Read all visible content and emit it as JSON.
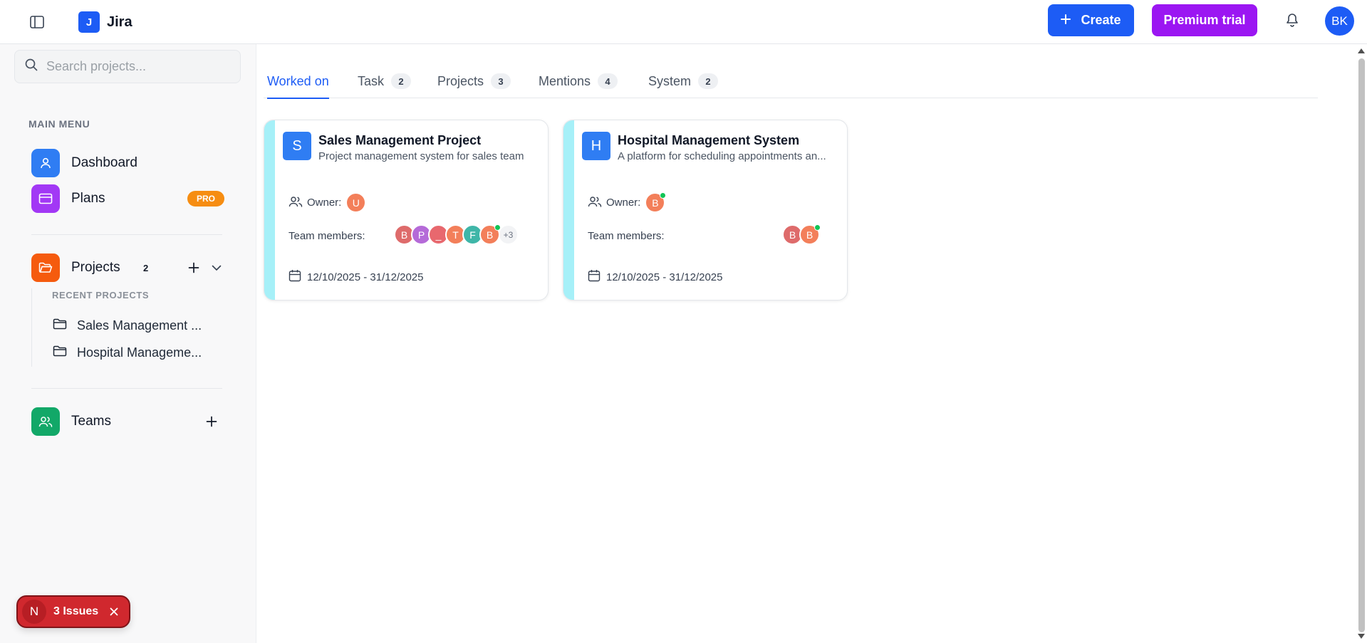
{
  "app": {
    "logo_letter": "J",
    "name": "Jira"
  },
  "header": {
    "create_label": "Create",
    "premium_label": "Premium trial",
    "user_initials": "BK"
  },
  "sidebar": {
    "search_placeholder": "Search projects...",
    "main_menu_title": "MAIN MENU",
    "dashboard_label": "Dashboard",
    "plans_label": "Plans",
    "plans_badge": "PRO",
    "projects_label": "Projects",
    "projects_count": "2",
    "recent_title": "RECENT PROJECTS",
    "recent_projects": [
      "Sales Management ...",
      "Hospital Manageme..."
    ],
    "teams_label": "Teams"
  },
  "issues": {
    "letter": "N",
    "label": "3 Issues"
  },
  "tabs": [
    {
      "label": "Worked on",
      "count": ""
    },
    {
      "label": "Task",
      "count": "2"
    },
    {
      "label": "Projects",
      "count": "3"
    },
    {
      "label": "Mentions",
      "count": "4"
    },
    {
      "label": "System",
      "count": "2"
    }
  ],
  "cards": [
    {
      "letter": "S",
      "title": "Sales Management Project",
      "description": "Project management system for sales team",
      "owner_label": "Owner:",
      "owner_initial": "U",
      "team_label": "Team members:",
      "team_initials": [
        "B",
        "P",
        "_",
        "T",
        "F",
        "B"
      ],
      "team_more": "+3",
      "dates": "12/10/2025 - 31/12/2025"
    },
    {
      "letter": "H",
      "title": "Hospital Management System",
      "description": "A platform for scheduling appointments an...",
      "owner_label": "Owner:",
      "owner_initial": "B",
      "team_label": "Team members:",
      "team_initials": [
        "B",
        "B"
      ],
      "dates": "12/10/2025 - 31/12/2025"
    }
  ],
  "colors": {
    "primary": "#1d5cf5",
    "premium": "#9b16f2",
    "pro_badge": "#f68d12",
    "card_strip": "#a6f0f8",
    "issues": "#d0282e",
    "online": "#12c456"
  }
}
